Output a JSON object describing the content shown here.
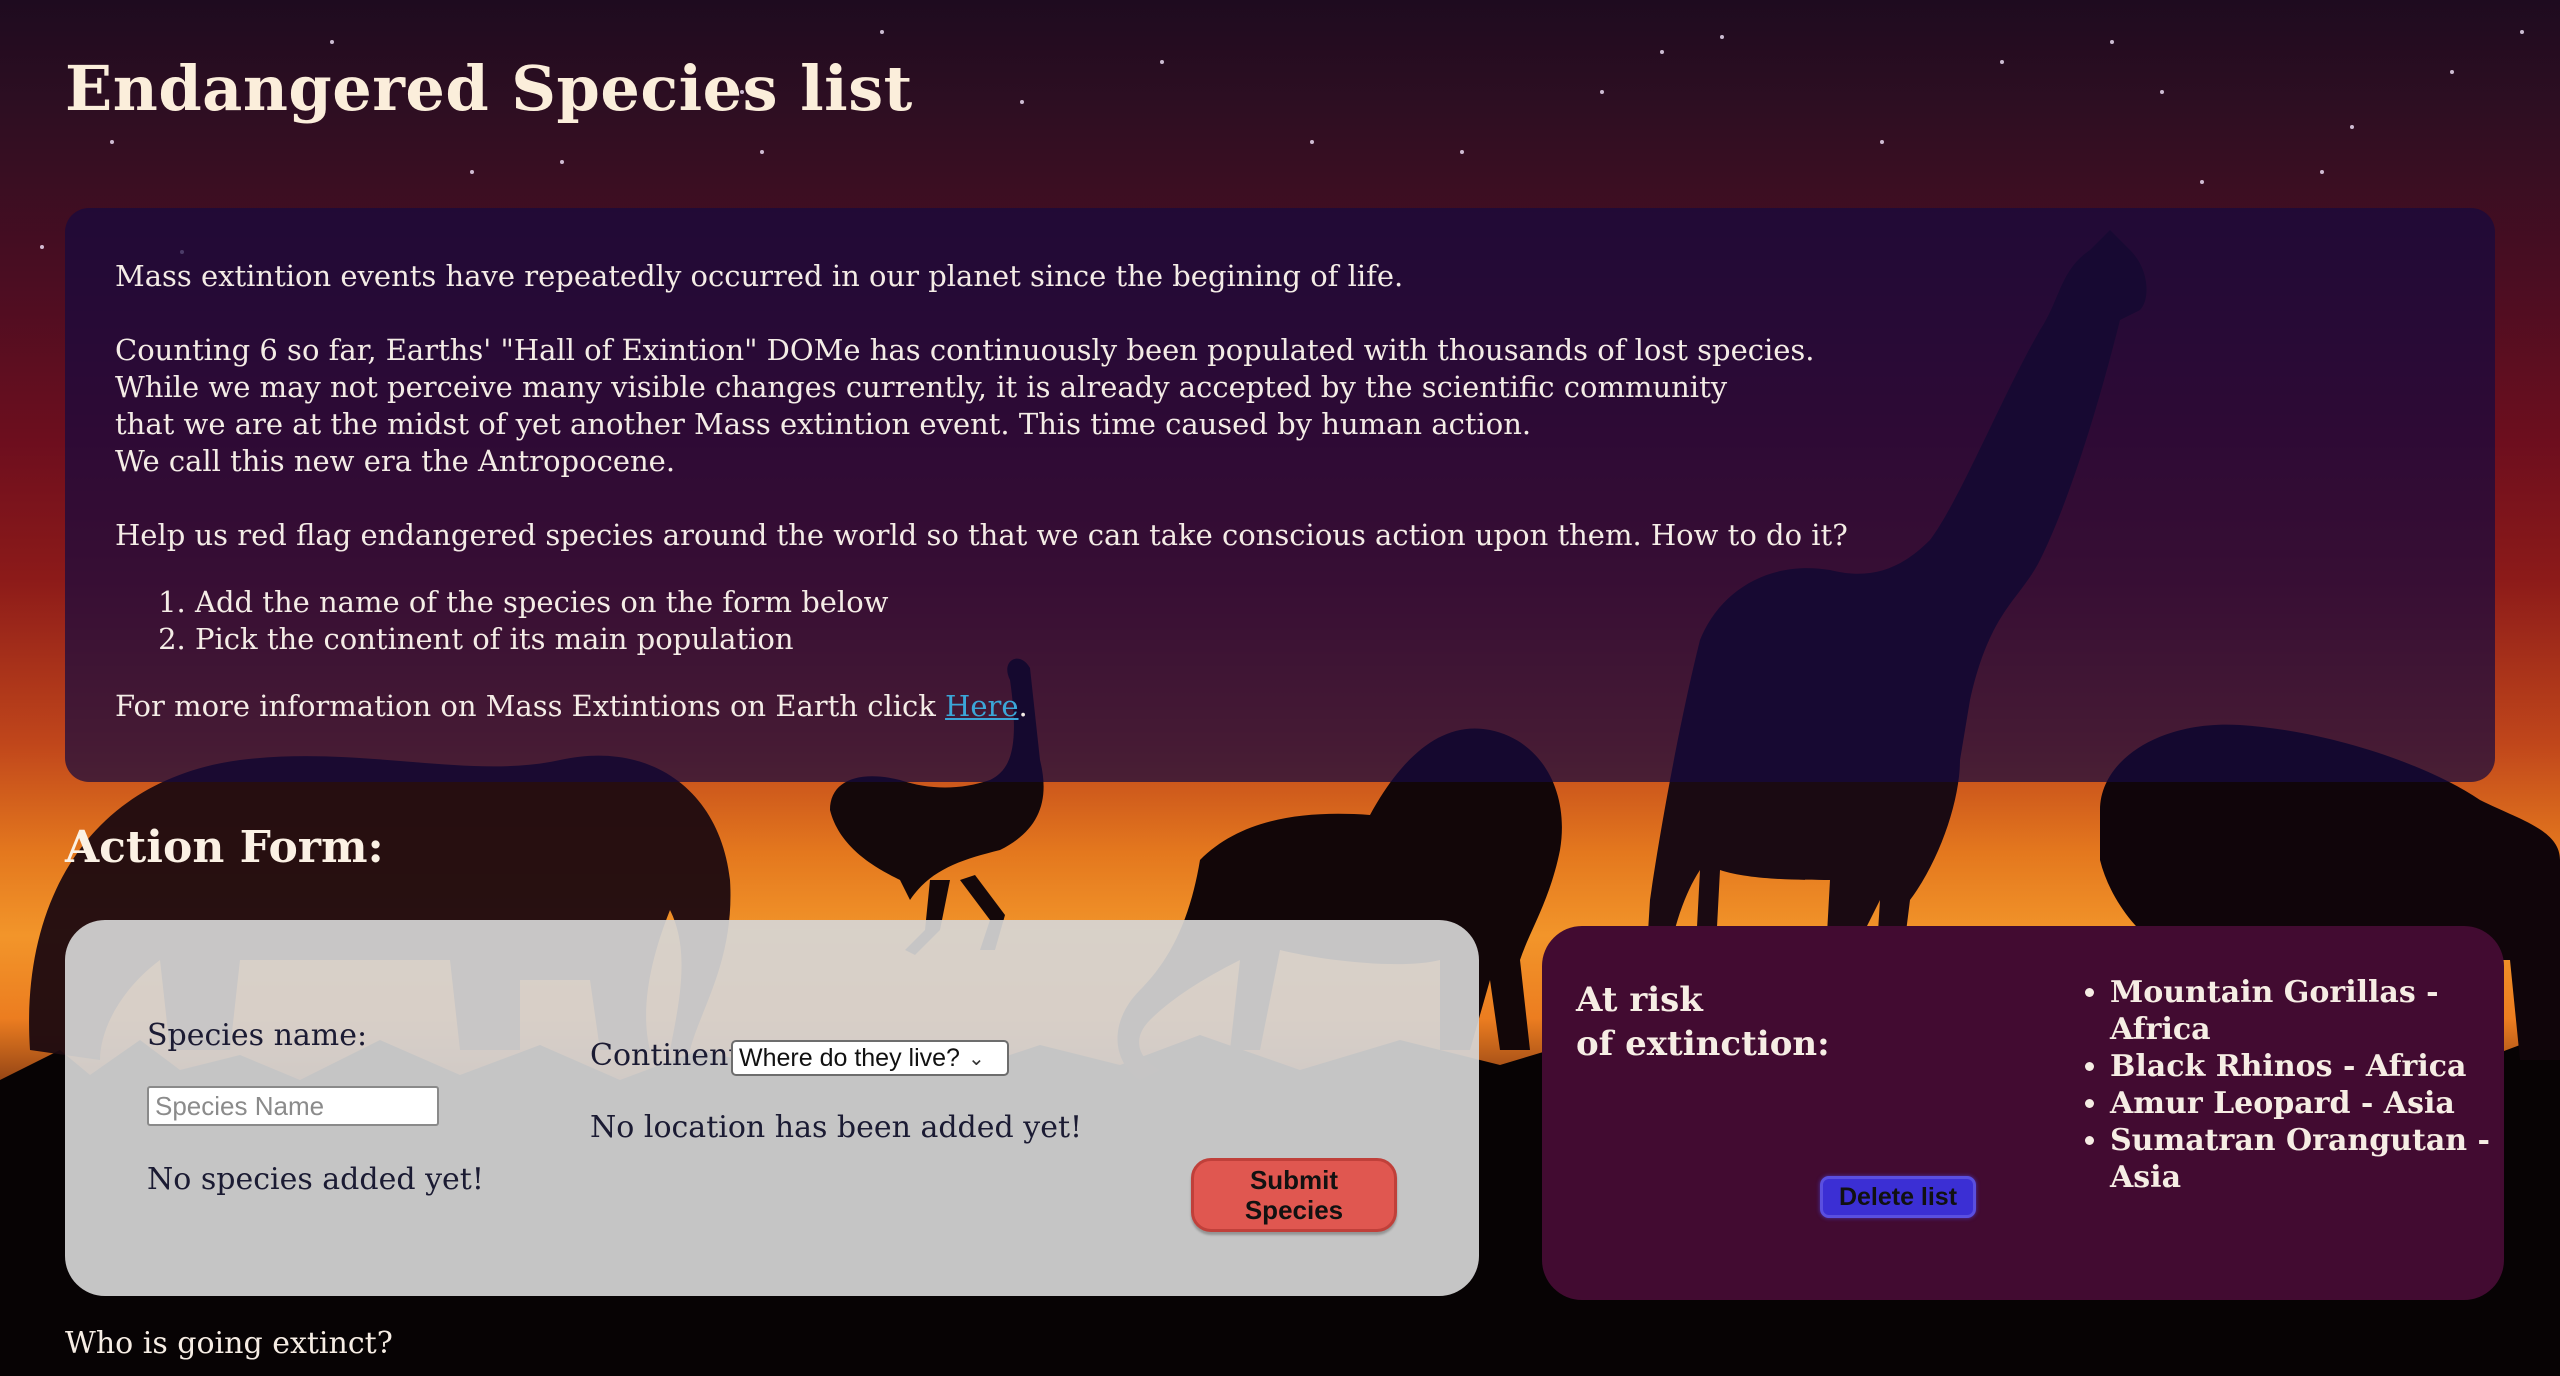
{
  "page": {
    "title": "Endangered Species list"
  },
  "intro": {
    "line1": "Mass extintion events have repeatedly occurred in our planet since the begining of life.",
    "line2": "Counting 6 so far, Earths' \"Hall of Exintion\" DOMe has continuously been populated with thousands of lost species.",
    "line3": "While we may not perceive many visible changes currently, it is already accepted by the scientific community",
    "line4": "that we are at the midst of yet another Mass extintion event. This time caused by human action.",
    "line5": "We call this new era the Antropocene.",
    "help": "Help us red flag endangered species around the world so that we can take conscious action upon them. How to do it?",
    "steps": [
      "Add the name of the species on the form below",
      "Pick the continent of its main population"
    ],
    "more_info_prefix": "For more information on Mass Extintions on Earth click ",
    "more_info_link": "Here",
    "more_info_suffix": "."
  },
  "form": {
    "section_title": "Action Form:",
    "species_label": "Species name:",
    "species_placeholder": "Species Name",
    "species_status": "No species added yet!",
    "continent_label": "Continent",
    "continent_selected": "Where do they live?",
    "location_status": "No location has been added yet!",
    "submit_label": "Submit Species"
  },
  "risk": {
    "title_line1": "At risk",
    "title_line2": "of extinction:",
    "items": [
      "Mountain Gorillas - Africa",
      "Black Rhinos - Africa",
      "Amur Leopard - Asia",
      "Sumatran Orangutan - Asia"
    ],
    "delete_label": "Delete list"
  },
  "footer": {
    "question": "Who is going extinct?"
  },
  "colors": {
    "intro_panel": "#160a3e",
    "form_panel": "#d6d6d6",
    "risk_panel": "#420b31",
    "submit_button": "#e05750",
    "delete_button": "#3b2fd4",
    "link": "#3ba6d8"
  },
  "background": {
    "description_icons": [
      "elephant-silhouette",
      "ostrich-silhouette",
      "lion-silhouette",
      "giraffe-silhouette",
      "rhino-silhouette",
      "grass-silhouette",
      "stars"
    ]
  }
}
